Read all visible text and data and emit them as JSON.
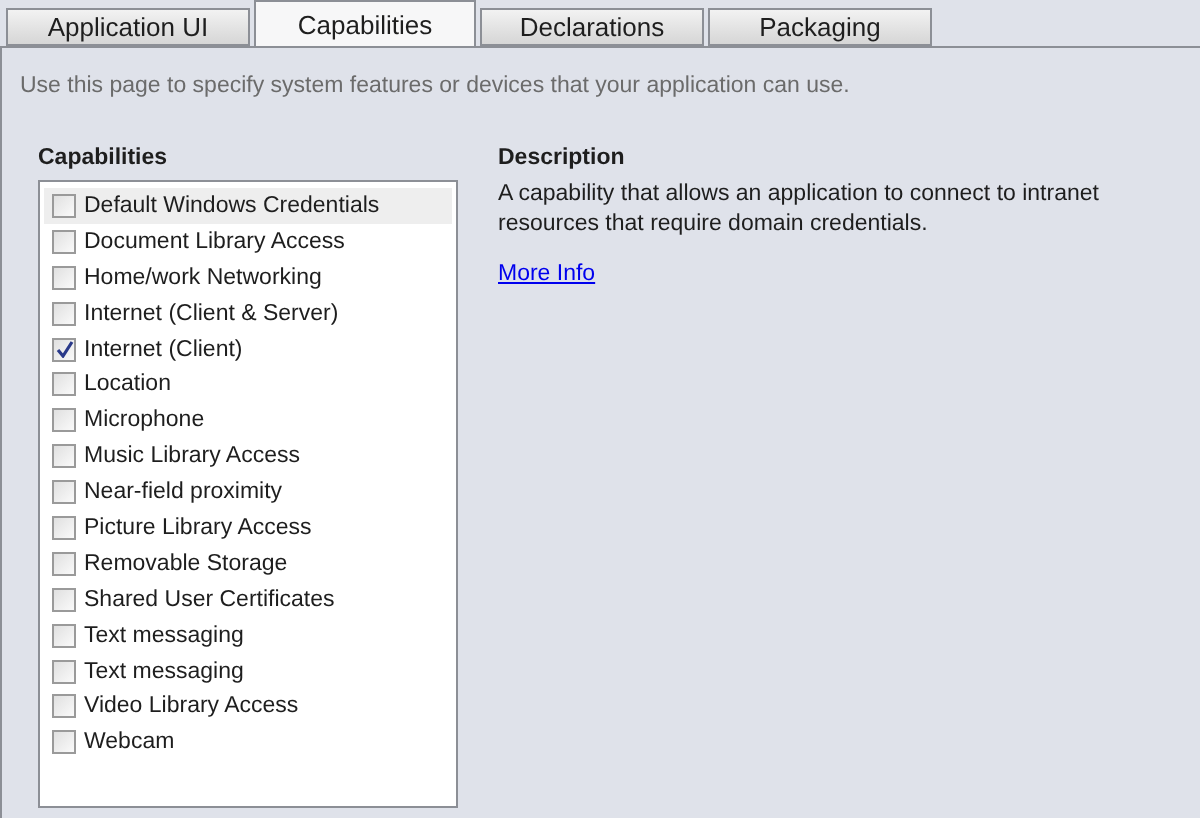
{
  "tabs": [
    {
      "label": "Application UI",
      "selected": false
    },
    {
      "label": "Capabilities",
      "selected": true
    },
    {
      "label": "Declarations",
      "selected": false
    },
    {
      "label": "Packaging",
      "selected": false
    }
  ],
  "intro": "Use this page to specify system features or devices that your application can use.",
  "capabilities": {
    "heading": "Capabilities",
    "items": [
      {
        "label": "Default Windows Credentials",
        "checked": false,
        "selected": true
      },
      {
        "label": "Document Library Access",
        "checked": false,
        "selected": false
      },
      {
        "label": "Home/work Networking",
        "checked": false,
        "selected": false
      },
      {
        "label": "Internet (Client & Server)",
        "checked": false,
        "selected": false
      },
      {
        "label": "Internet (Client)",
        "checked": true,
        "selected": false
      },
      {
        "label": "Location",
        "checked": false,
        "selected": false
      },
      {
        "label": "Microphone",
        "checked": false,
        "selected": false
      },
      {
        "label": "Music Library Access",
        "checked": false,
        "selected": false
      },
      {
        "label": "Near-field proximity",
        "checked": false,
        "selected": false
      },
      {
        "label": "Picture Library Access",
        "checked": false,
        "selected": false
      },
      {
        "label": "Removable Storage",
        "checked": false,
        "selected": false
      },
      {
        "label": "Shared User Certificates",
        "checked": false,
        "selected": false
      },
      {
        "label": "Text messaging",
        "checked": false,
        "selected": false
      },
      {
        "label": "Text messaging",
        "checked": false,
        "selected": false
      },
      {
        "label": "Video Library Access",
        "checked": false,
        "selected": false
      },
      {
        "label": "Webcam",
        "checked": false,
        "selected": false
      }
    ]
  },
  "description": {
    "heading": "Description",
    "text": "A capability that allows an application to connect to intranet resources that require domain credentials.",
    "link": "More Info"
  }
}
